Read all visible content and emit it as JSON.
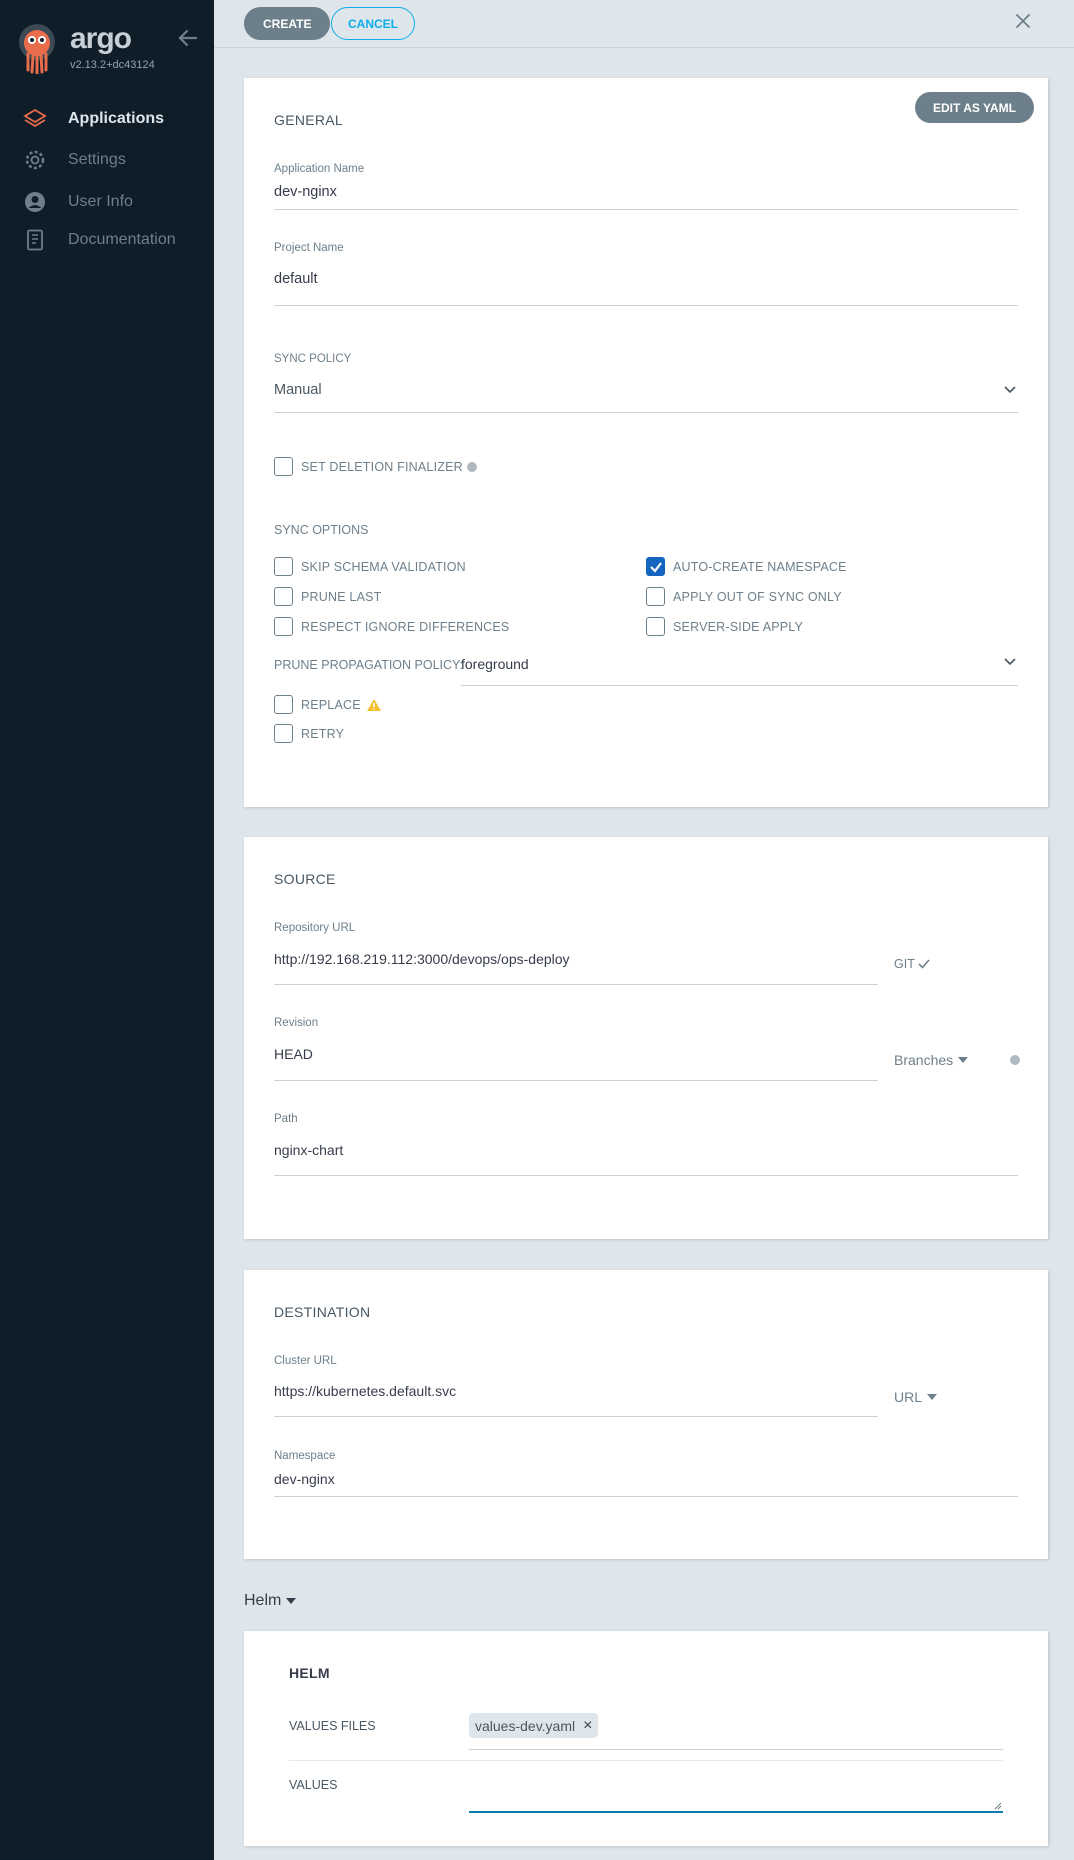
{
  "sidebar": {
    "brand": "argo",
    "version": "v2.13.2+dc43124",
    "items": [
      {
        "label": "Applications",
        "icon": "layers-icon"
      },
      {
        "label": "Settings",
        "icon": "gear-icon"
      },
      {
        "label": "User Info",
        "icon": "user-icon"
      },
      {
        "label": "Documentation",
        "icon": "book-icon"
      }
    ]
  },
  "toolbar": {
    "create_label": "CREATE",
    "cancel_label": "CANCEL"
  },
  "general": {
    "edit_yaml_label": "EDIT AS YAML",
    "title": "GENERAL",
    "app_name_label": "Application Name",
    "app_name_value": "dev-nginx",
    "project_label": "Project Name",
    "project_value": "default",
    "sync_policy_label": "SYNC POLICY",
    "sync_policy_value": "Manual",
    "deletion_finalizer_label": "SET DELETION FINALIZER",
    "sync_options_title": "SYNC OPTIONS",
    "options": {
      "skip_schema": "SKIP SCHEMA VALIDATION",
      "prune_last": "PRUNE LAST",
      "respect_ignore": "RESPECT IGNORE DIFFERENCES",
      "auto_create_ns": "AUTO-CREATE NAMESPACE",
      "apply_out_of_sync": "APPLY OUT OF SYNC ONLY",
      "server_side": "SERVER-SIDE APPLY"
    },
    "prune_policy_label": "PRUNE PROPAGATION POLICY:",
    "prune_policy_value": "foreground",
    "replace_label": "REPLACE",
    "retry_label": "RETRY"
  },
  "source": {
    "title": "SOURCE",
    "repo_label": "Repository URL",
    "repo_value": "http://192.168.219.112:3000/devops/ops-deploy",
    "repo_type": "GIT",
    "revision_label": "Revision",
    "revision_value": "HEAD",
    "revision_mode": "Branches",
    "path_label": "Path",
    "path_value": "nginx-chart"
  },
  "destination": {
    "title": "DESTINATION",
    "cluster_label": "Cluster URL",
    "cluster_value": "https://kubernetes.default.svc",
    "cluster_mode": "URL",
    "namespace_label": "Namespace",
    "namespace_value": "dev-nginx"
  },
  "helm": {
    "toggle_label": "Helm",
    "title": "HELM",
    "values_files_label": "VALUES FILES",
    "values_file_tag": "values-dev.yaml",
    "values_label": "VALUES"
  },
  "colors": {
    "sidebar_bg": "#0e1d28",
    "page_bg": "#dee6eb",
    "accent": "#0dadea",
    "checkbox_checked": "#1565c0",
    "argo_orange": "#e96d4c"
  }
}
